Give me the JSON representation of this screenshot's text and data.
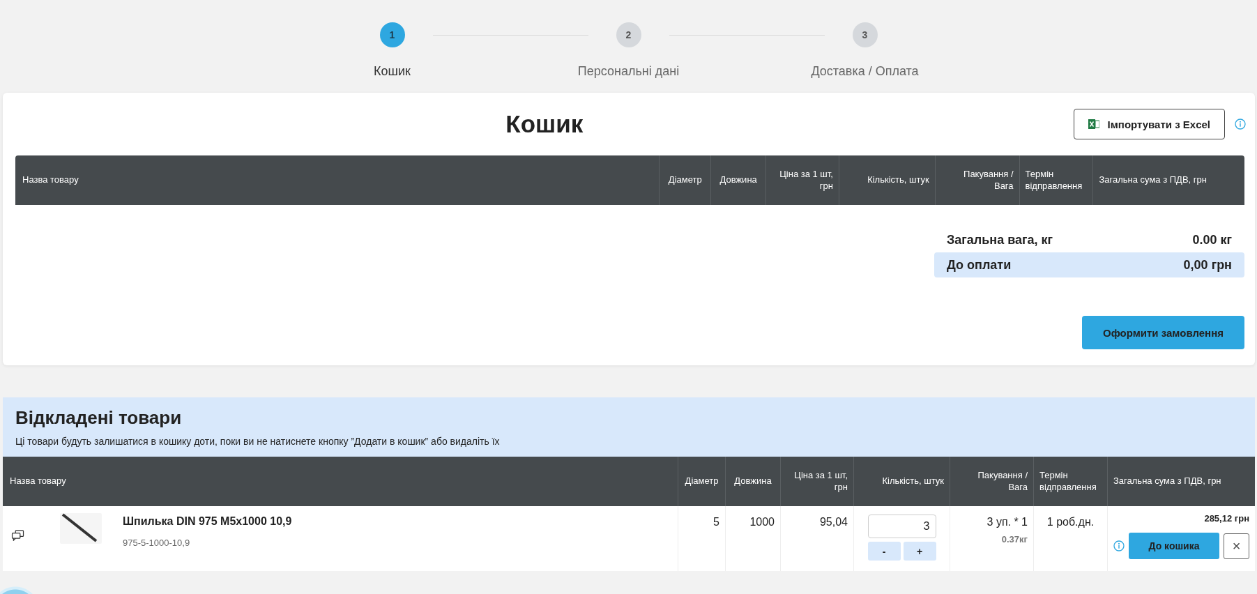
{
  "steps": [
    {
      "number": "1",
      "label": "Кошик",
      "selected": true
    },
    {
      "number": "2",
      "label": "Персональні дані",
      "selected": false
    },
    {
      "number": "3",
      "label": "Доставка / Оплата",
      "selected": false
    }
  ],
  "cart": {
    "title": "Кошик",
    "import_button": "Імпортувати з Excel",
    "table": {
      "columns": [
        "Назва товару",
        "Діаметр",
        "Довжина",
        "Ціна за 1 шт, грн",
        "Кількість, штук",
        "Пакування / Вага",
        "Термін відправлення",
        "Загальна сума з ПДВ, грн"
      ]
    },
    "summary": [
      {
        "label": "Загальна вага, кг",
        "value": "0.00 кг",
        "highlighted": false
      },
      {
        "label": "До оплати",
        "value": "0,00 грн",
        "highlighted": true
      }
    ],
    "checkout_button": "Оформити замовлення"
  },
  "deferred": {
    "title": "Відкладені товари",
    "note": "Ці товари будуть залишатися в кошику доти, поки ви не натиснете кнопку ”Додати в кошик” або видаліть їх",
    "table": {
      "columns": [
        "Назва товару",
        "Діаметр",
        "Довжина",
        "Ціна за 1 шт, грн",
        "Кількість, штук",
        "Пакування / Вага",
        "Термін відправлення",
        "Загальна сума з ПДВ, грн"
      ],
      "rows": [
        {
          "name": "Шпилька DIN 975 M5x1000 10,9",
          "sku": "975-5-1000-10,9",
          "diameter": "5",
          "length": "1000",
          "price": "95,04",
          "quantity": "3",
          "minus": "-",
          "plus": "+",
          "packaging": "3 уп. * 1",
          "weight": "0.37кг",
          "term": "1 роб.дн.",
          "total": "285,12 грн",
          "add_button": "До кошика",
          "remove_button": "×"
        }
      ]
    }
  }
}
